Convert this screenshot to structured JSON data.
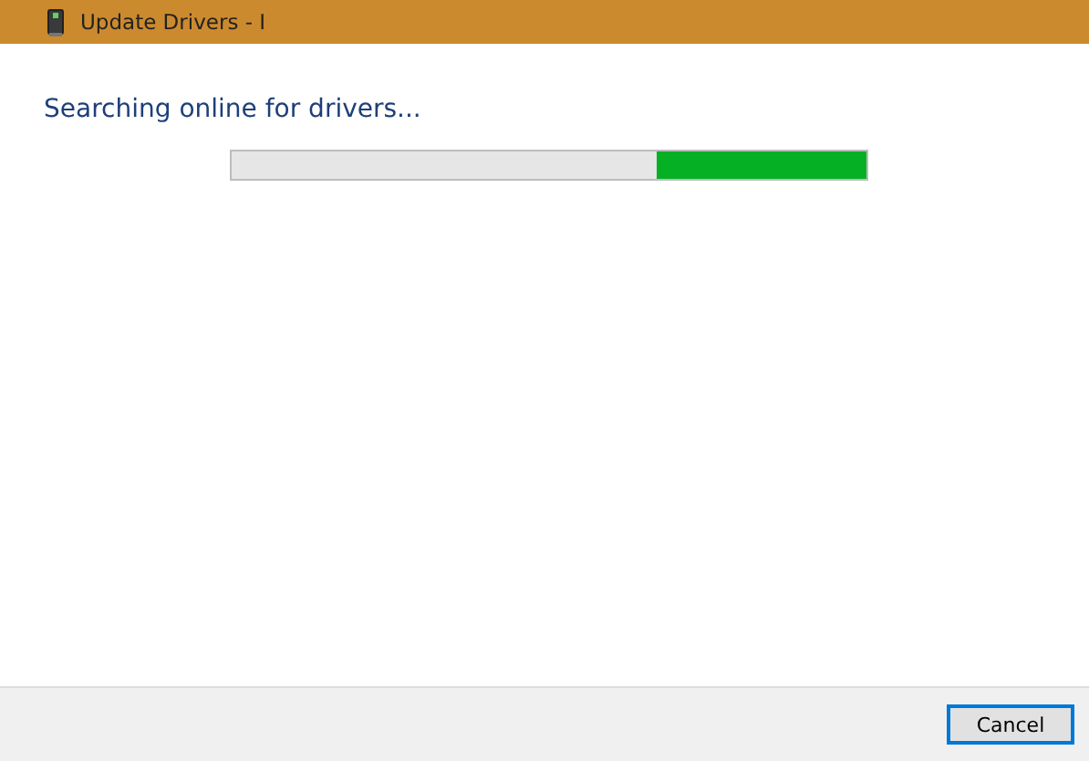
{
  "window": {
    "title": "Update Drivers - I"
  },
  "heading": "Searching online for drivers...",
  "progress": {
    "level": 0.33
  },
  "buttons": [
    {
      "label": "Cancel",
      "selected": true
    }
  ]
}
